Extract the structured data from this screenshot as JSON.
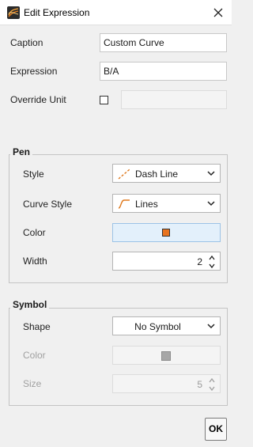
{
  "window": {
    "title": "Edit Expression",
    "app_icon": "curve-app-icon",
    "close_icon": "close-icon"
  },
  "fields": {
    "caption": {
      "label": "Caption",
      "value": "Custom Curve"
    },
    "expression": {
      "label": "Expression",
      "value": "B/A"
    },
    "override_unit": {
      "label": "Override Unit",
      "checked": false,
      "value": ""
    }
  },
  "pen": {
    "title": "Pen",
    "style": {
      "label": "Style",
      "value": "Dash Line",
      "icon": "dash-line-icon"
    },
    "curve_style": {
      "label": "Curve Style",
      "value": "Lines",
      "icon": "curve-lines-icon"
    },
    "color": {
      "label": "Color",
      "swatch": "#e8731f"
    },
    "width": {
      "label": "Width",
      "value": "2"
    }
  },
  "symbol": {
    "title": "Symbol",
    "shape": {
      "label": "Shape",
      "value": "No Symbol"
    },
    "color": {
      "label": "Color",
      "swatch": "#a6a6a6"
    },
    "size": {
      "label": "Size",
      "value": "5"
    }
  },
  "buttons": {
    "ok": "OK"
  }
}
